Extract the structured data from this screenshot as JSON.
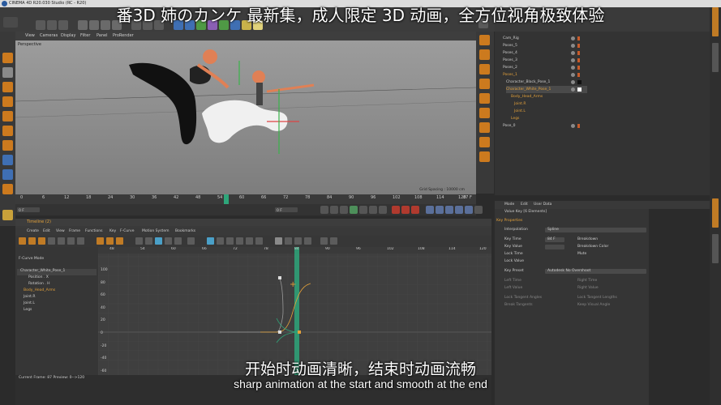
{
  "app_title": "CINEMA 4D R20.030 Studio (RC - R20)",
  "overlay_text": "番3D 姉のカンケ 最新集，成人限定 3D 动画，全方位视角极致体验",
  "viewport": {
    "label": "Perspective",
    "menu": [
      "View",
      "Cameras",
      "Display",
      "Filter",
      "Panel",
      "ProRender"
    ],
    "grid_spacing": "Grid Spacing : 10000 cm"
  },
  "timeline": {
    "ticks": [
      "0",
      "6",
      "12",
      "18",
      "24",
      "30",
      "36",
      "42",
      "48",
      "54",
      "60",
      "66",
      "72",
      "78",
      "84",
      "90",
      "96",
      "102",
      "108",
      "114",
      "120"
    ],
    "current_frame": "87 F",
    "start_field": "0 F",
    "field2": "0 F",
    "field3": "120 F",
    "end_field": "120 F"
  },
  "object_manager": {
    "items": [
      {
        "name": "Cam_Rig",
        "color": "#cfcfcf"
      },
      {
        "name": "Poses_5",
        "color": "#cfcfcf"
      },
      {
        "name": "Poses_4",
        "color": "#cfcfcf"
      },
      {
        "name": "Poses_3",
        "color": "#cfcfcf"
      },
      {
        "name": "Poses_2",
        "color": "#cfcfcf"
      },
      {
        "name": "Poses_1",
        "color": "#e3a13a"
      },
      {
        "name": "Character_Black_Pose_1",
        "color": "#cfcfcf"
      },
      {
        "name": "Character_White_Pose_1",
        "color": "#e3a13a"
      },
      {
        "name": "Body_Head_Arms",
        "color": "#e3a13a"
      },
      {
        "name": "Joint.R",
        "color": "#e3a13a"
      },
      {
        "name": "Joint.L",
        "color": "#e3a13a"
      },
      {
        "name": "Legs",
        "color": "#e3a13a"
      },
      {
        "name": "Pose_0",
        "color": "#cfcfcf"
      }
    ]
  },
  "timeline_window": {
    "title": "Timeline (2)",
    "menu": [
      "Create",
      "Edit",
      "View",
      "Frame",
      "Functions",
      "Key",
      "F-Curve",
      "Motion System",
      "Bookmarks"
    ],
    "mode_label": "F-Curve Mode",
    "tracks": [
      {
        "name": "Character_White_Pose_1",
        "color": "#cfcfcf"
      },
      {
        "name": "Position . X",
        "color": "#cfcfcf"
      },
      {
        "name": "Rotation . H",
        "color": "#cfcfcf"
      },
      {
        "name": "Body_Head_Arms",
        "color": "#e3a13a"
      },
      {
        "name": "Joint.R",
        "color": "#cfcfcf"
      },
      {
        "name": "Joint.L",
        "color": "#cfcfcf"
      },
      {
        "name": "Legs",
        "color": "#cfcfcf"
      }
    ],
    "frame_ticks": [
      "48",
      "54",
      "60",
      "66",
      "72",
      "78",
      "84",
      "90",
      "96",
      "102",
      "108",
      "114",
      "120"
    ],
    "value_ticks": [
      "100",
      "80",
      "60",
      "40",
      "20",
      "0",
      "-20",
      "-40",
      "-60"
    ],
    "status": "Current Frame: 87  Preview: 0-->120"
  },
  "attributes": {
    "menu": [
      "Mode",
      "Edit",
      "User Data"
    ],
    "header": "Value Key [6 Elements]",
    "section1": "Key Properties",
    "rows": [
      {
        "label": "Interpolation",
        "value": "Spline"
      },
      {
        "label": "Key Time",
        "value": "84 F"
      },
      {
        "label": "Key Value",
        "value": ""
      },
      {
        "label": "Lock Time",
        "value": ""
      },
      {
        "label": "Lock Value",
        "value": ""
      },
      {
        "label": "Mute",
        "value": ""
      }
    ],
    "right_rows": [
      "Breakdown",
      "Breakdown Color",
      "Mute"
    ],
    "preset_label": "Key Preset",
    "preset_value": "Autodesk No Overshoot",
    "tangents": [
      "Left Time",
      "Left Value",
      "Right Time",
      "Right Value"
    ],
    "locks": [
      "Lock Tangent Angles",
      "Lock Tangent Lengths",
      "Break Tangents",
      "Keep Visual Angle"
    ]
  },
  "captions": {
    "chinese": "开始时动画清晰，结束时动画流畅",
    "english": "sharp animation at the start and smooth at the end"
  },
  "colors": {
    "accent_orange": "#cc7a1e",
    "playhead_green": "#2ea67a",
    "curve_orange": "#e3a13a"
  }
}
